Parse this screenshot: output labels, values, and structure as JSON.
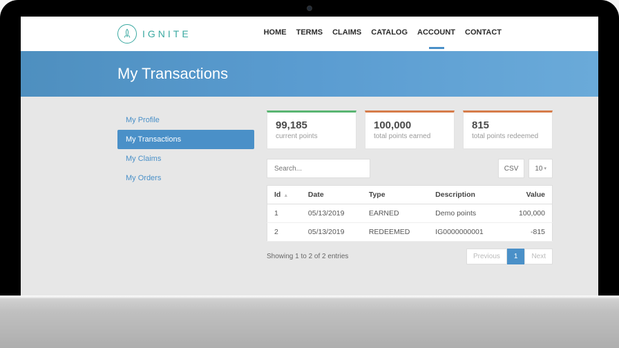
{
  "brand": {
    "name": "IGNITE"
  },
  "nav": {
    "items": [
      {
        "label": "HOME"
      },
      {
        "label": "TERMS"
      },
      {
        "label": "CLAIMS"
      },
      {
        "label": "CATALOG"
      },
      {
        "label": "ACCOUNT"
      },
      {
        "label": "CONTACT"
      }
    ],
    "active_index": 4
  },
  "banner": {
    "title": "My Transactions"
  },
  "sidenav": {
    "items": [
      {
        "label": "My Profile"
      },
      {
        "label": "My Transactions"
      },
      {
        "label": "My Claims"
      },
      {
        "label": "My Orders"
      }
    ],
    "active_index": 1
  },
  "cards": [
    {
      "value": "99,185",
      "label": "current points",
      "color": "green"
    },
    {
      "value": "100,000",
      "label": "total points earned",
      "color": "orange"
    },
    {
      "value": "815",
      "label": "total points redeemed",
      "color": "orange"
    }
  ],
  "search": {
    "placeholder": "Search..."
  },
  "export_label": "CSV",
  "page_size": "10",
  "table": {
    "headers": [
      "Id",
      "Date",
      "Type",
      "Description",
      "Value"
    ],
    "rows": [
      {
        "id": "1",
        "date": "05/13/2019",
        "type": "EARNED",
        "desc": "Demo points",
        "value": "100,000"
      },
      {
        "id": "2",
        "date": "05/13/2019",
        "type": "REDEEMED",
        "desc": "IG0000000001",
        "value": "-815"
      }
    ]
  },
  "entries_text": "Showing 1 to 2 of 2 entries",
  "pager": {
    "prev": "Previous",
    "page": "1",
    "next": "Next"
  }
}
